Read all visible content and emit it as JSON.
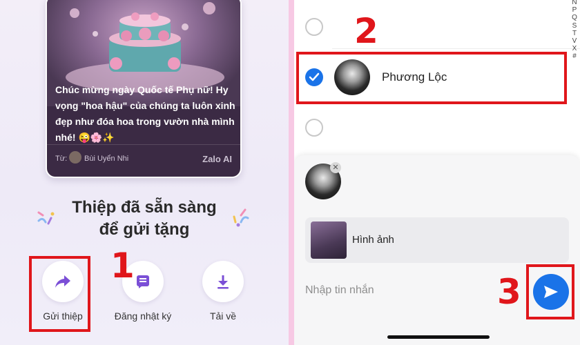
{
  "left": {
    "card": {
      "message": "Chúc mừng ngày Quốc tế Phụ nữ! Hy vọng \"hoa hậu\" của chúng ta luôn xinh đẹp như đóa hoa trong vườn nhà mình nhé! 😜🌸✨",
      "from_label": "Từ:",
      "from_name": "Bùi Uyển Nhi",
      "brand": "Zalo AI"
    },
    "ready_title_line1": "Thiệp đã sẵn sàng",
    "ready_title_line2": "để gửi tặng",
    "actions": [
      {
        "label": "Gửi thiệp",
        "icon": "share-forward-icon"
      },
      {
        "label": "Đăng nhật ký",
        "icon": "diary-post-icon"
      },
      {
        "label": "Tải về",
        "icon": "download-icon"
      }
    ],
    "step1": "1"
  },
  "right": {
    "alphabet": [
      "N",
      "P",
      "Q",
      "S",
      "T",
      "V",
      "X",
      "#"
    ],
    "selected_contact": "Phương Lộc",
    "step2": "2",
    "attachment_label": "Hình ảnh",
    "message_placeholder": "Nhập tin nhắn",
    "remove_symbol": "✕",
    "step3": "3"
  },
  "colors": {
    "highlight": "#e0161b",
    "accent": "#1a73e8",
    "icon_purple": "#7b4fd6"
  }
}
